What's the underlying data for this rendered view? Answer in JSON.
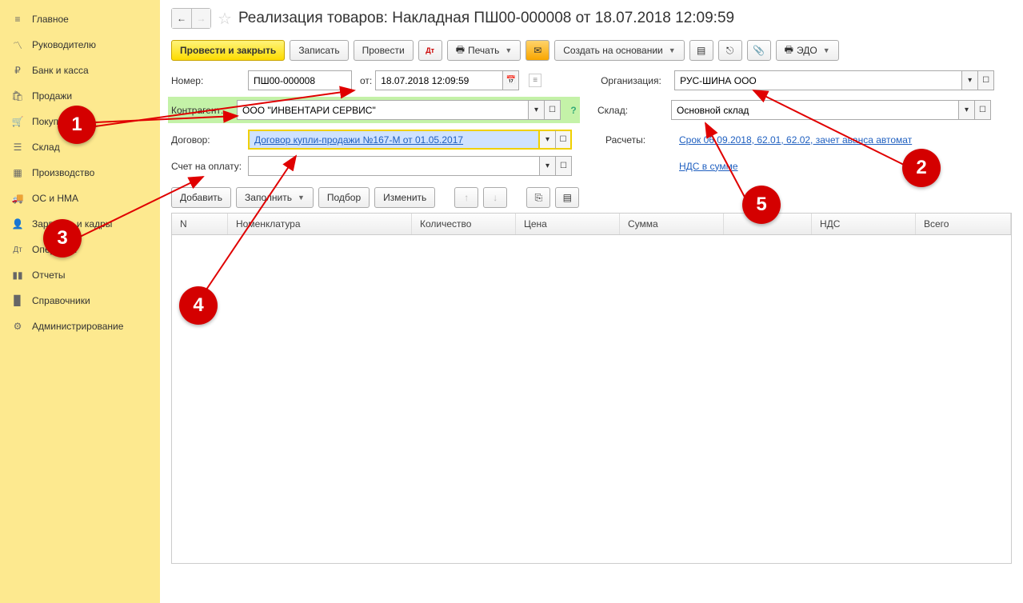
{
  "sidebar": {
    "items": [
      {
        "label": "Главное",
        "icon": "≡"
      },
      {
        "label": "Руководителю",
        "icon": "📈"
      },
      {
        "label": "Банк и касса",
        "icon": "₽"
      },
      {
        "label": "Продажи",
        "icon": "🛍"
      },
      {
        "label": "Покупки",
        "icon": "🛒"
      },
      {
        "label": "Склад",
        "icon": "📋"
      },
      {
        "label": "Производство",
        "icon": "🏭"
      },
      {
        "label": "ОС и НМА",
        "icon": "🚚"
      },
      {
        "label": "Зарплата и кадры",
        "icon": "👤"
      },
      {
        "label": "Операции",
        "icon": "ᴬᵀ"
      },
      {
        "label": "Отчеты",
        "icon": "📊"
      },
      {
        "label": "Справочники",
        "icon": "📕"
      },
      {
        "label": "Администрирование",
        "icon": "⚙"
      }
    ]
  },
  "title": "Реализация товаров: Накладная ПШ00-000008 от 18.07.2018 12:09:59",
  "toolbar": {
    "post_close": "Провести и закрыть",
    "write": "Записать",
    "post": "Провести",
    "print": "Печать",
    "create_based": "Создать на основании",
    "edo": "ЭДО"
  },
  "fields": {
    "number_label": "Номер:",
    "number_value": "ПШ00-000008",
    "from_label": "от:",
    "date_value": "18.07.2018 12:09:59",
    "org_label": "Организация:",
    "org_value": "РУС-ШИНА ООО",
    "counterparty_label": "Контрагент:",
    "counterparty_value": "ООО \"ИНВЕНТАРИ СЕРВИС\"",
    "warehouse_label": "Склад:",
    "warehouse_value": "Основной склад",
    "contract_label": "Договор:",
    "contract_value": "Договор купли-продажи №167-М от 01.05.2017",
    "calc_label": "Расчеты:",
    "calc_link": "Срок 06.09.2018, 62.01, 62.02, зачет аванса автомат",
    "invoice_label": "Счет на оплату:",
    "nds_link": "НДС в сумме"
  },
  "table_toolbar": {
    "add": "Добавить",
    "fill": "Заполнить",
    "pick": "Подбор",
    "change": "Изменить"
  },
  "table": {
    "headers": [
      "N",
      "Номенклатура",
      "Количество",
      "Цена",
      "Сумма",
      "",
      "НДС",
      "Всего"
    ]
  },
  "markers": {
    "m1": "1",
    "m2": "2",
    "m3": "3",
    "m4": "4",
    "m5": "5"
  }
}
